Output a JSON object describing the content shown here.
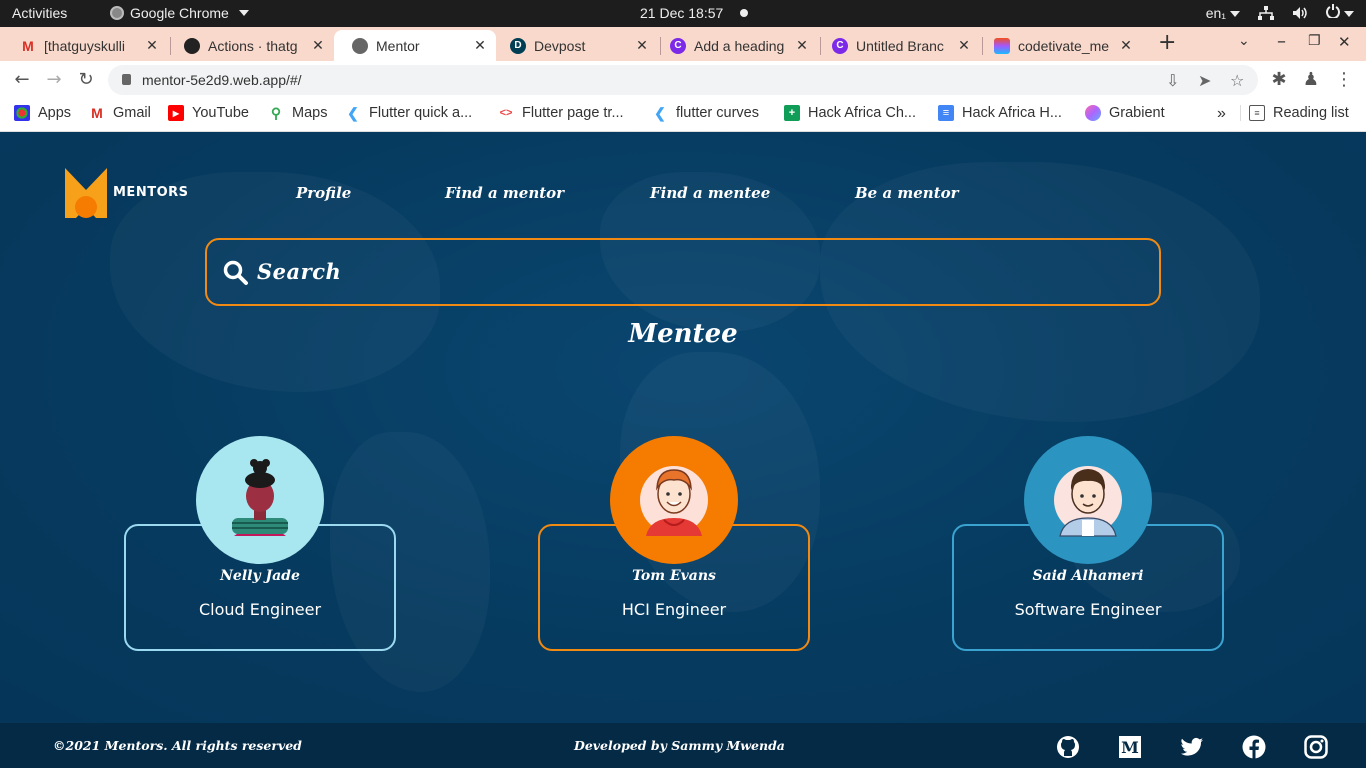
{
  "system_bar": {
    "activities": "Activities",
    "app_name": "Google Chrome",
    "clock": "21 Dec  18:57",
    "lang": "en₁"
  },
  "tabs": [
    {
      "title": "[thatguyskulli",
      "favicon": "gmail-icon",
      "active": false
    },
    {
      "title": "Actions · thatg",
      "favicon": "github-icon",
      "active": false
    },
    {
      "title": "Mentor",
      "favicon": "globe-icon",
      "active": true
    },
    {
      "title": "Devpost",
      "favicon": "devpost-icon",
      "active": false
    },
    {
      "title": "Add a heading",
      "favicon": "canva-icon",
      "active": false
    },
    {
      "title": "Untitled Branc",
      "favicon": "canva-icon",
      "active": false
    },
    {
      "title": "codetivate_me",
      "favicon": "figma-icon",
      "active": false
    }
  ],
  "address_bar": {
    "url": "mentor-5e2d9.web.app/#/"
  },
  "bookmarks": [
    {
      "label": "Apps",
      "icon": "apps-grid-icon"
    },
    {
      "label": "Gmail",
      "icon": "gmail-icon"
    },
    {
      "label": "YouTube",
      "icon": "youtube-icon"
    },
    {
      "label": "Maps",
      "icon": "maps-icon"
    },
    {
      "label": "Flutter quick a...",
      "icon": "flutter-icon"
    },
    {
      "label": "Flutter page tr...",
      "icon": "code-icon"
    },
    {
      "label": "flutter curves",
      "icon": "flutter-icon"
    },
    {
      "label": "Hack Africa Ch...",
      "icon": "sheets-icon"
    },
    {
      "label": "Hack Africa H...",
      "icon": "docs-icon"
    },
    {
      "label": "Grabient",
      "icon": "grabient-icon"
    }
  ],
  "bookmarks_more": "»",
  "reading_list": "Reading list",
  "app": {
    "brand": "MENTORS",
    "nav": {
      "profile": "Profile",
      "find_mentor": "Find a mentor",
      "find_mentee": "Find a mentee",
      "be_mentor": "Be a mentor"
    },
    "search_placeholder": "Search",
    "heading": "Mentee",
    "mentees": [
      {
        "name": "Nelly Jade",
        "role": "Cloud Engineer",
        "avatar_bg": "#a8e6f0",
        "border": "#9ad9f0"
      },
      {
        "name": "Tom Evans",
        "role": "HCI Engineer",
        "avatar_bg": "#f57c00",
        "border": "#f08a12"
      },
      {
        "name": "Said Alhameri",
        "role": "Software Engineer",
        "avatar_bg": "#2b94c0",
        "border": "#3aa3d0"
      }
    ],
    "footer": {
      "copyright": "©2021 Mentors. All rights reserved",
      "developer": "Developed by Sammy Mwenda"
    }
  },
  "colors": {
    "page_bg": "#063a5e",
    "footer_bg": "#042a45",
    "accent": "#f08a12",
    "tab_strip": "#f9d9cc"
  }
}
